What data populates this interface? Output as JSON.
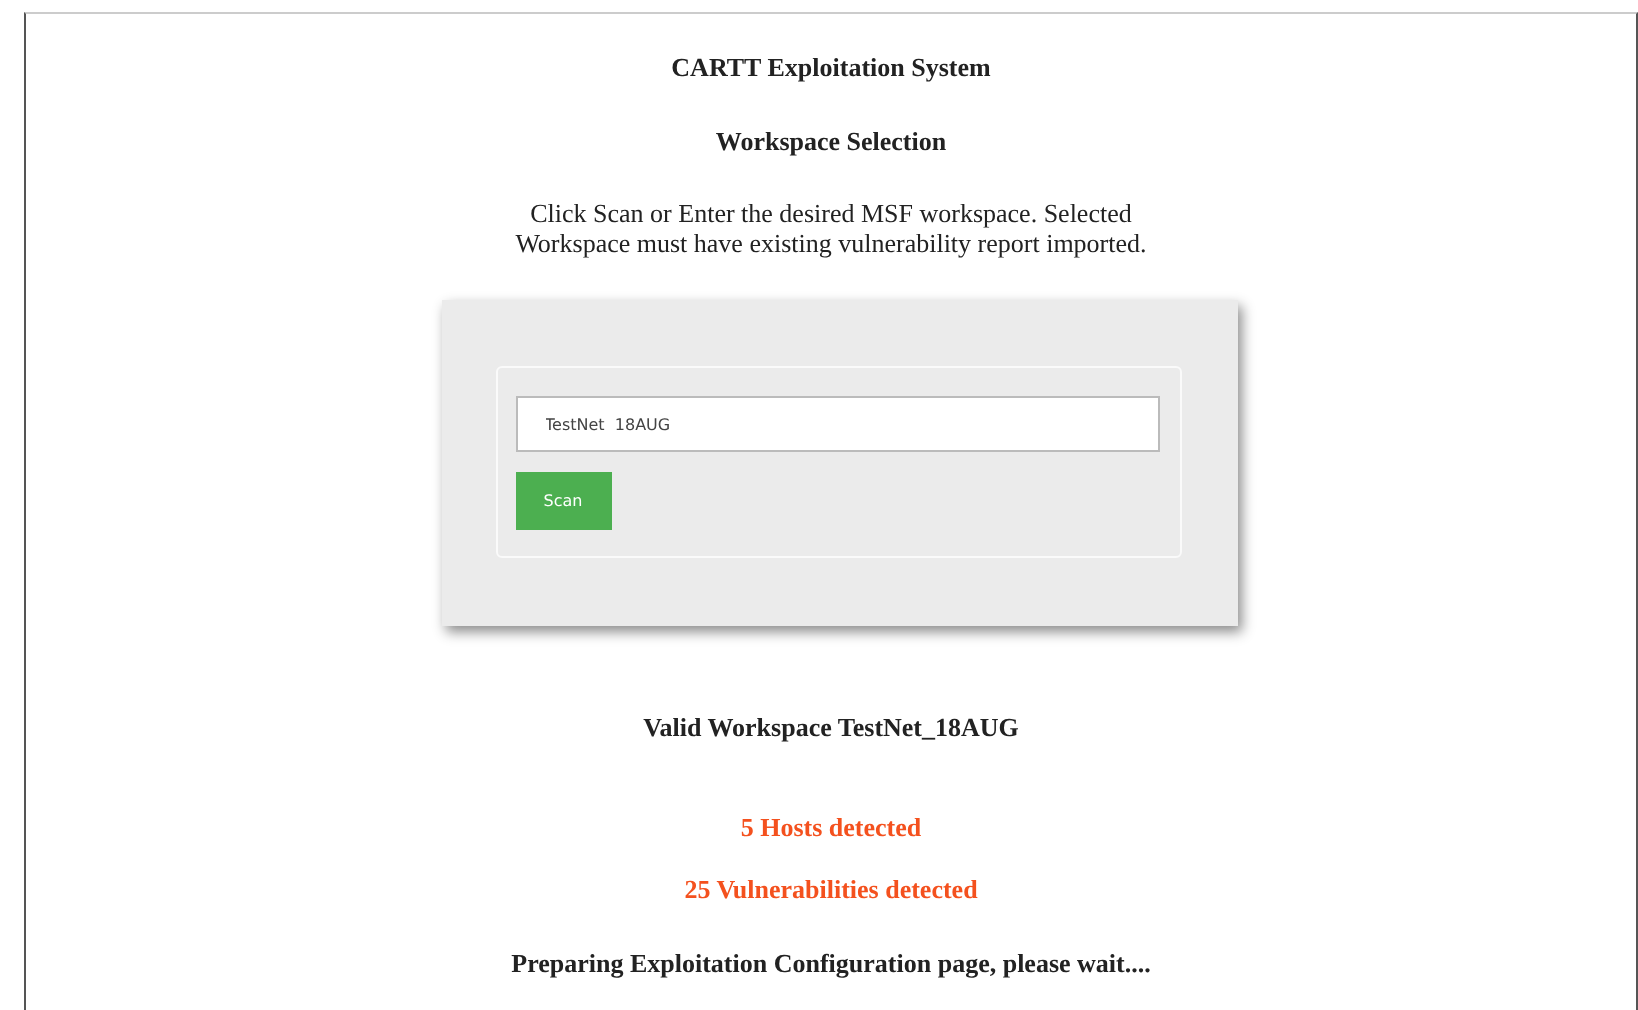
{
  "title": "CARTT Exploitation System",
  "subtitle": "Workspace Selection",
  "instructions": "Click Scan or Enter the desired MSF workspace. Selected\nWorkspace must have existing vulnerability report imported.",
  "workspace_field": {
    "value": "TestNet  18AUG"
  },
  "scan_button": "Scan",
  "messages": [
    {
      "kind": "plain",
      "text": "Valid Workspace TestNet_18AUG"
    },
    {
      "kind": "alert",
      "text": "5 Hosts detected"
    },
    {
      "kind": "alert",
      "text": "25 Vulnerabilities detected"
    },
    {
      "kind": "plain",
      "text": "Preparing Exploitation Configuration page, please wait...."
    }
  ]
}
